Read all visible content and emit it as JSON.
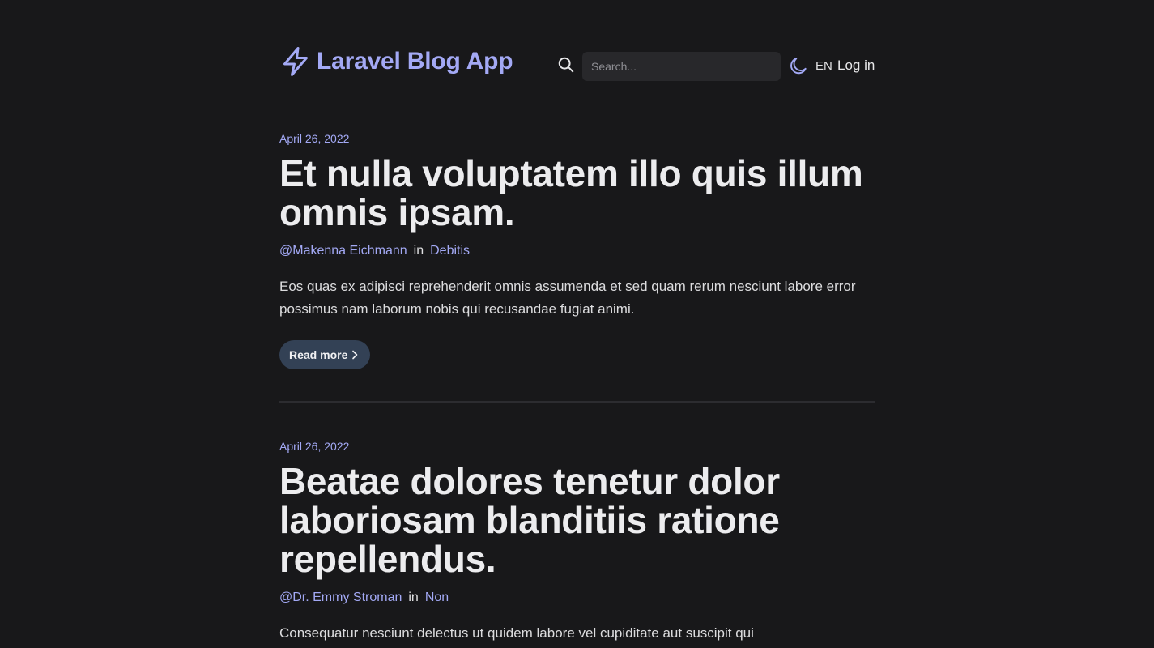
{
  "header": {
    "brand_title": "Laravel Blog App",
    "search_placeholder": "Search...",
    "language": "EN",
    "login_label": "Log in"
  },
  "colors": {
    "background": "#18181a",
    "accent": "#a3a9f5",
    "button": "#334155"
  },
  "posts": [
    {
      "date": "April 26, 2022",
      "title": "Et nulla voluptatem illo quis illum omnis ipsam.",
      "author": "@Makenna Eichmann",
      "in_label": "in",
      "category": "Debitis",
      "excerpt": "Eos quas ex adipisci reprehenderit omnis assumenda et sed quam rerum nesciunt labore error possimus nam laborum nobis qui recusandae fugiat animi.",
      "read_more_label": "Read more"
    },
    {
      "date": "April 26, 2022",
      "title": "Beatae dolores tenetur dolor laboriosam blanditiis ratione repellendus.",
      "author": "@Dr. Emmy Stroman",
      "in_label": "in",
      "category": "Non",
      "excerpt": "Consequatur nesciunt delectus ut quidem labore vel cupiditate aut suscipit qui"
    }
  ]
}
